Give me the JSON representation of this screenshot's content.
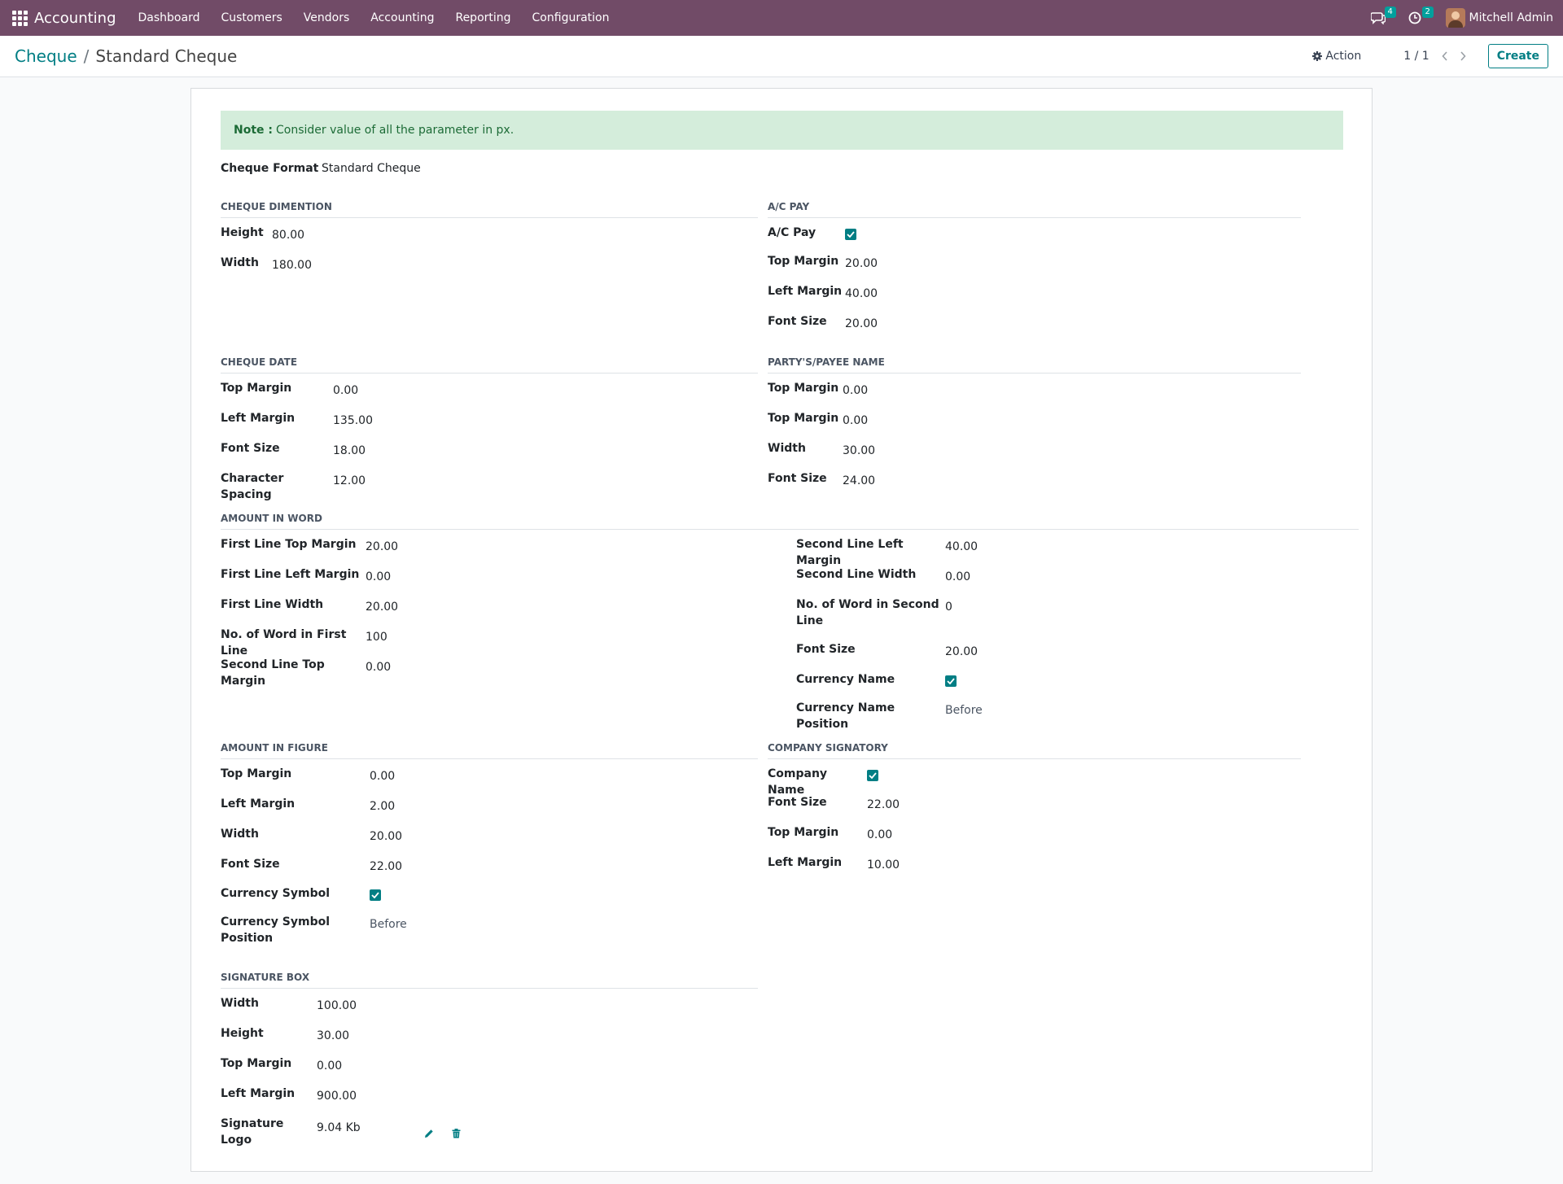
{
  "navbar": {
    "brand": "Accounting",
    "menu": [
      "Dashboard",
      "Customers",
      "Vendors",
      "Accounting",
      "Reporting",
      "Configuration"
    ],
    "messages_count": "4",
    "activities_count": "2",
    "user_name": "Mitchell Admin"
  },
  "control": {
    "breadcrumb_parent": "Cheque",
    "breadcrumb_sep": "/",
    "breadcrumb_current": "Standard Cheque",
    "action_label": "Action",
    "pager": "1 / 1",
    "create_label": "Create"
  },
  "note": {
    "label": "Note :",
    "text": "Consider value of all the parameter in px."
  },
  "cheque_format": {
    "label": "Cheque Format",
    "value": "Standard Cheque"
  },
  "dimension": {
    "title": "CHEQUE DIMENTION",
    "height_label": "Height",
    "height": "80.00",
    "width_label": "Width",
    "width": "180.00"
  },
  "ac_pay": {
    "title": "A/C PAY",
    "ac_pay_label": "A/C Pay",
    "ac_pay_checked": true,
    "top_margin_label": "Top Margin",
    "top_margin": "20.00",
    "left_margin_label": "Left Margin",
    "left_margin": "40.00",
    "font_size_label": "Font Size",
    "font_size": "20.00"
  },
  "cheque_date": {
    "title": "CHEQUE DATE",
    "top_margin_label": "Top Margin",
    "top_margin": "0.00",
    "left_margin_label": "Left Margin",
    "left_margin": "135.00",
    "font_size_label": "Font Size",
    "font_size": "18.00",
    "char_spacing_label": "Character Spacing",
    "char_spacing": "12.00"
  },
  "payee": {
    "title": "PARTY'S/PAYEE NAME",
    "top_margin_label": "Top Margin",
    "top_margin": "0.00",
    "top_margin2_label": "Top Margin",
    "top_margin2": "0.00",
    "width_label": "Width",
    "width": "30.00",
    "font_size_label": "Font Size",
    "font_size": "24.00"
  },
  "amount_word": {
    "title": "AMOUNT IN WORD",
    "first_top_label": "First Line Top Margin",
    "first_top": "20.00",
    "first_left_label": "First Line Left Margin",
    "first_left": "0.00",
    "first_width_label": "First Line Width",
    "first_width": "20.00",
    "first_words_label": "No. of Word in First Line",
    "first_words": "100",
    "second_top_label": "Second Line Top Margin",
    "second_top": "0.00",
    "second_left_label": "Second Line Left Margin",
    "second_left": "40.00",
    "second_width_label": "Second Line Width",
    "second_width": "0.00",
    "second_words_label_1": "No. of Word in Second",
    "second_words_label_2": "Line",
    "second_words": "0",
    "font_size_label": "Font Size",
    "font_size": "20.00",
    "currency_name_label": "Currency Name",
    "currency_name_checked": true,
    "currency_pos_label": "Currency Name Position",
    "currency_pos": "Before"
  },
  "amount_figure": {
    "title": "AMOUNT IN FIGURE",
    "top_margin_label": "Top Margin",
    "top_margin": "0.00",
    "left_margin_label": "Left Margin",
    "left_margin": "2.00",
    "width_label": "Width",
    "width": "20.00",
    "font_size_label": "Font Size",
    "font_size": "22.00",
    "currency_symbol_label": "Currency Symbol",
    "currency_symbol_checked": true,
    "currency_symbol_pos_label_1": "Currency Symbol",
    "currency_symbol_pos_label_2": "Position",
    "currency_symbol_pos": "Before"
  },
  "signatory": {
    "title": "COMPANY SIGNATORY",
    "company_name_label": "Company Name",
    "company_name_checked": true,
    "font_size_label": "Font Size",
    "font_size": "22.00",
    "top_margin_label": "Top Margin",
    "top_margin": "0.00",
    "left_margin_label": "Left Margin",
    "left_margin": "10.00"
  },
  "signature_box": {
    "title": "SIGNATURE BOX",
    "width_label": "Width",
    "width": "100.00",
    "height_label": "Height",
    "height": "30.00",
    "top_margin_label": "Top Margin",
    "top_margin": "0.00",
    "left_margin_label": "Left Margin",
    "left_margin": "900.00",
    "logo_label": "Signature Logo",
    "logo_size": "9.04 Kb"
  },
  "colors": {
    "navbar": "#714b67",
    "accent": "#017e84",
    "note_bg": "#d4eddb",
    "note_text": "#1c6b36"
  },
  "icons": [
    "apps-icon",
    "chat-icon",
    "clock-icon",
    "gear-icon",
    "chevron-left-icon",
    "chevron-right-icon",
    "check-icon",
    "pencil-icon",
    "trash-icon"
  ]
}
